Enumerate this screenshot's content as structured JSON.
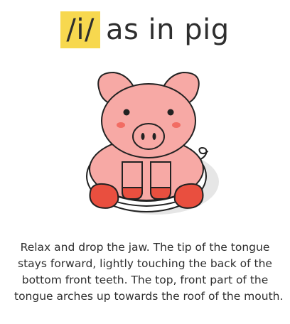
{
  "header": {
    "ipa_symbol": "/i/",
    "keyword_phrase": "as in pig"
  },
  "illustration": {
    "icon": "pig-icon",
    "colors": {
      "body": "#f7a9a5",
      "hooves": "#e94f3f",
      "cheeks": "#f26c63",
      "outline": "#222222",
      "shadow": "#e6e6e6"
    }
  },
  "description": {
    "lines": [
      "Relax and drop the jaw. The tip of the tongue",
      "stays forward, lightly touching the back of the",
      "bottom front teeth. The top, front part of the",
      "tongue arches up towards the roof of the mouth."
    ]
  },
  "colors": {
    "highlight": "#f7d84f",
    "text": "#2e2e2e"
  }
}
